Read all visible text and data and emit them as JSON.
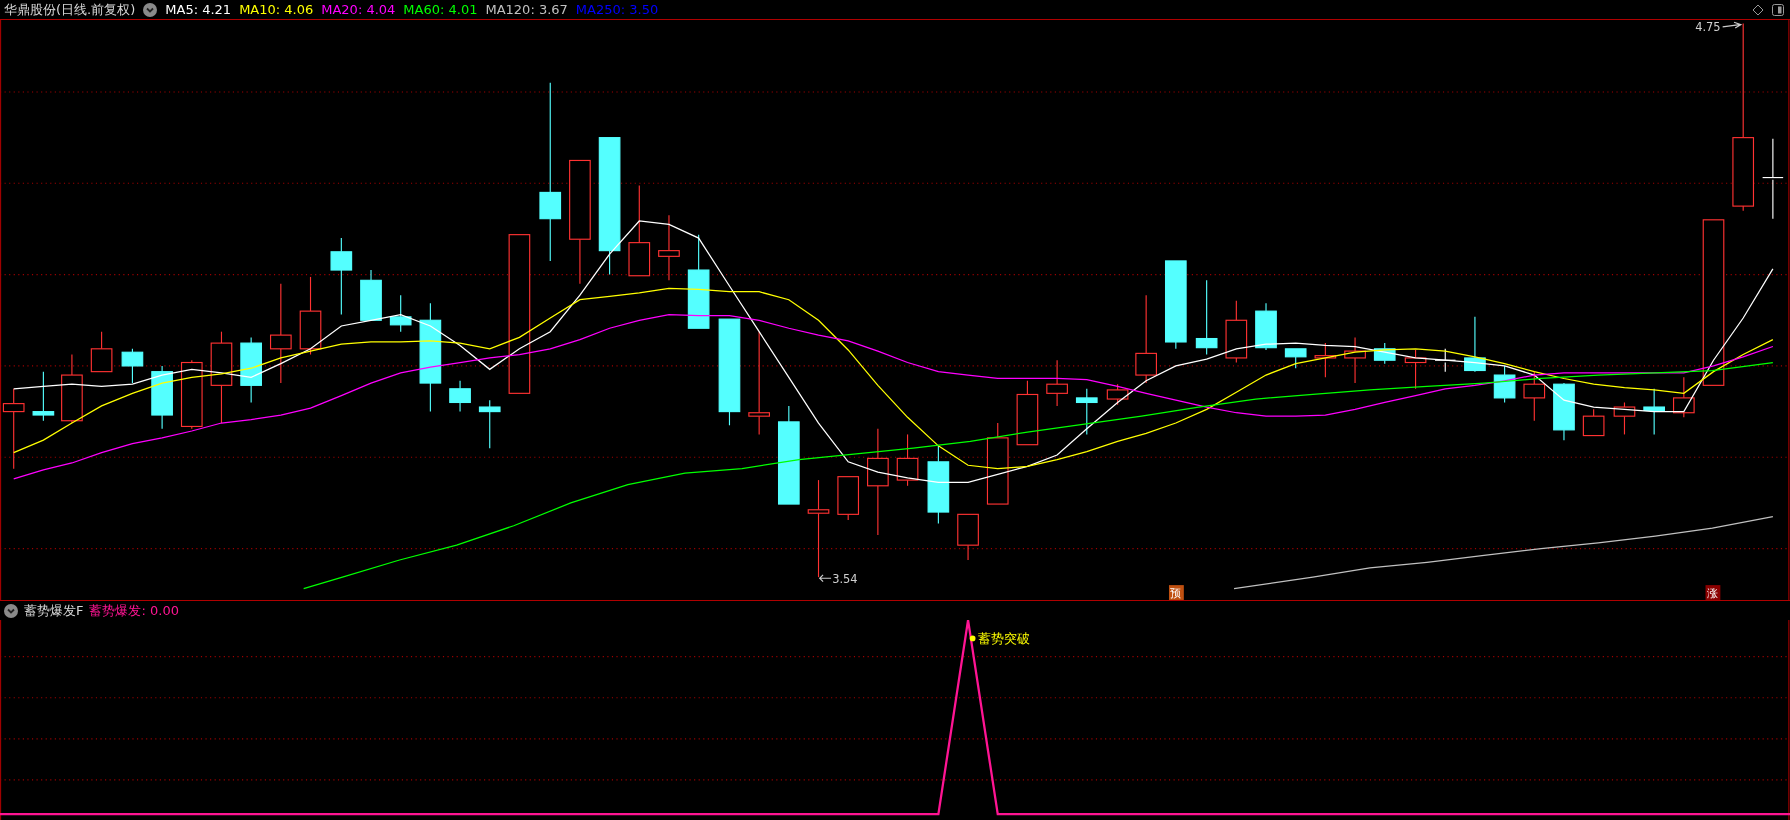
{
  "header": {
    "title": "华鼎股份(日线.前复权)",
    "ma_legend": [
      {
        "label": "MA5: 4.21",
        "color": "#ffffff"
      },
      {
        "label": "MA10: 4.06",
        "color": "#ffff00"
      },
      {
        "label": "MA20: 4.04",
        "color": "#ff00ff"
      },
      {
        "label": "MA60: 4.01",
        "color": "#00ff00"
      },
      {
        "label": "MA120: 3.67",
        "color": "#c0c0c0"
      },
      {
        "label": "MA250: 3.50",
        "color": "#0000ff"
      }
    ]
  },
  "price_chart": {
    "high_label": "4.75",
    "low_label": "3.54",
    "signals": [
      {
        "label": "预",
        "color": "#c05010"
      },
      {
        "label": "涨",
        "color": "#8b0000"
      }
    ]
  },
  "indicator": {
    "title": "蓄势爆发F",
    "reading": "蓄势爆发: 0.00",
    "signal_label": "蓄势突破"
  }
}
